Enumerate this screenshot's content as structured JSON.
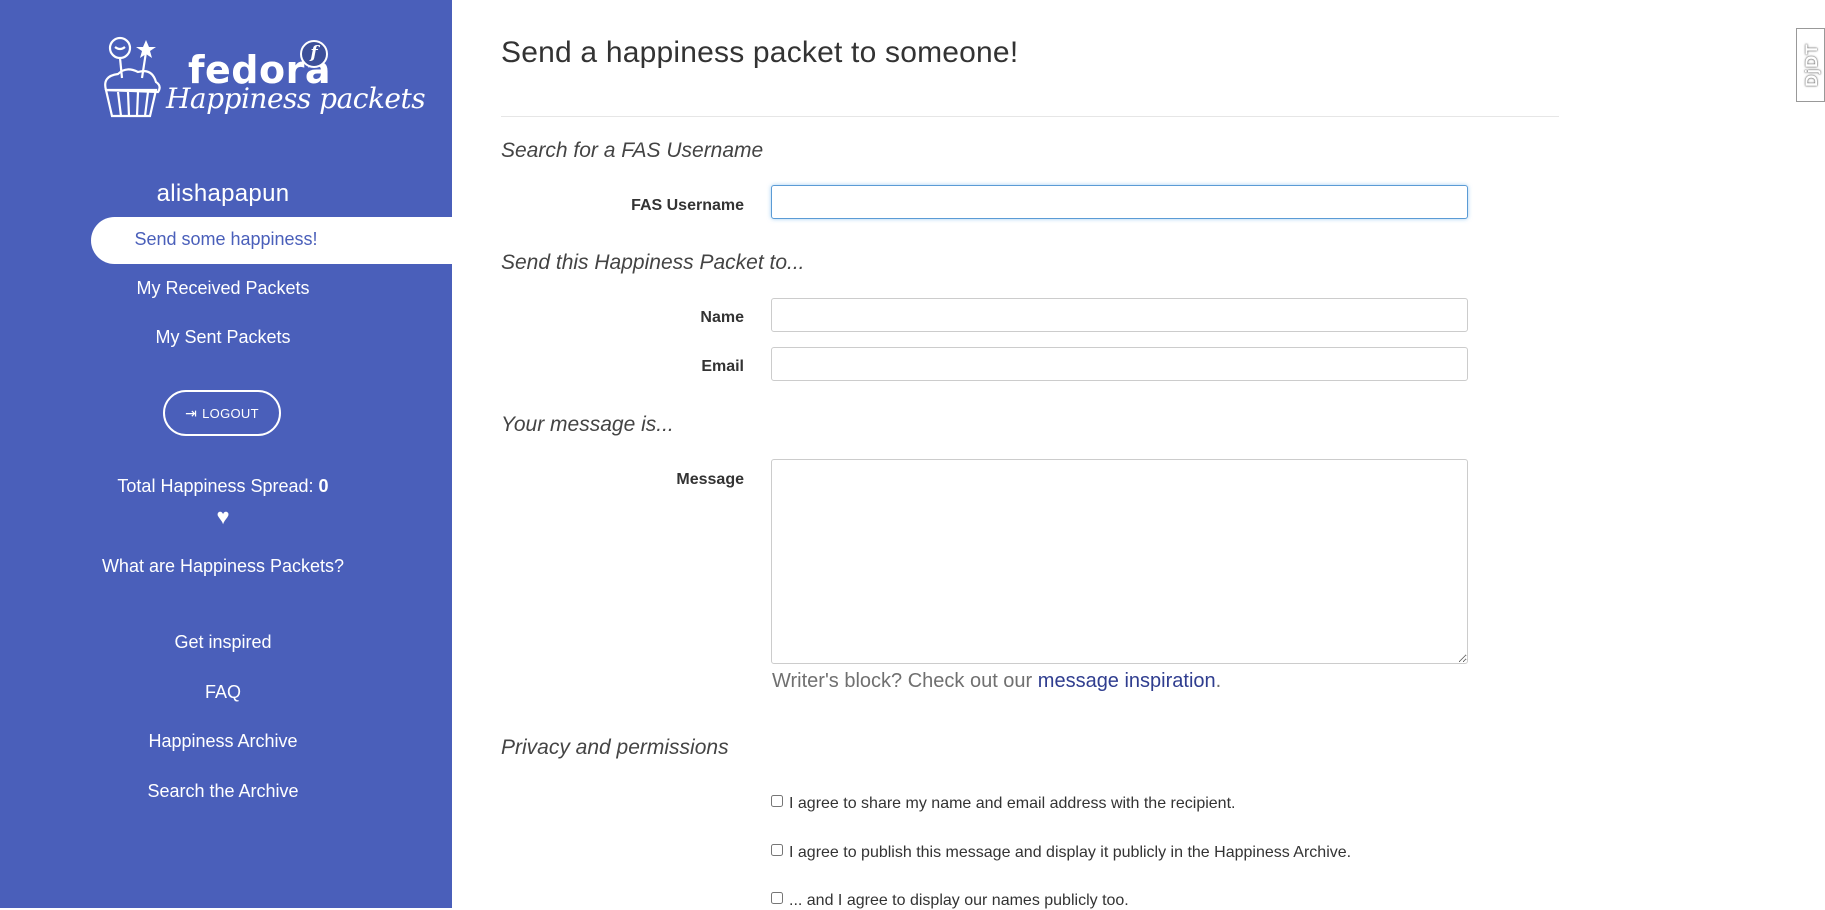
{
  "sidebar": {
    "logo": {
      "brand": "fedora",
      "badge": "f",
      "tagline": "Happiness packets"
    },
    "username": "alishapapun",
    "nav": {
      "active": "Send some happiness!",
      "received": "My Received Packets",
      "sent": "My Sent Packets"
    },
    "logout_label": "LOGOUT",
    "total": {
      "label": "Total Happiness Spread: ",
      "value": "0"
    },
    "heart_glyph": "♥",
    "links": {
      "what_are": "What are Happiness Packets?",
      "inspired": "Get inspired",
      "faq": "FAQ",
      "archive": "Happiness Archive",
      "search_archive": "Search the Archive"
    }
  },
  "main": {
    "title": "Send a happiness packet to someone!",
    "search_section": "Search for a FAS Username",
    "fas_label": "FAS Username",
    "fas_value": "",
    "recipient_section": "Send this Happiness Packet to...",
    "name_label": "Name",
    "email_label": "Email",
    "message_section": "Your message is...",
    "message_label": "Message",
    "help_prefix": "Writer's block? Check out our ",
    "help_link": "message inspiration",
    "help_suffix": ".",
    "privacy_section": "Privacy and permissions",
    "checks": {
      "share": "I agree to share my name and email address with the recipient.",
      "publish": "I agree to publish this message and display it publicly in the Happiness Archive.",
      "names": "... and I agree to display our names publicly too."
    }
  },
  "ddt_badge": "DjDT",
  "colors": {
    "sidebar_bg": "#4a5fba",
    "link": "#2f3d8f",
    "focus_border": "#5b9bd5"
  }
}
